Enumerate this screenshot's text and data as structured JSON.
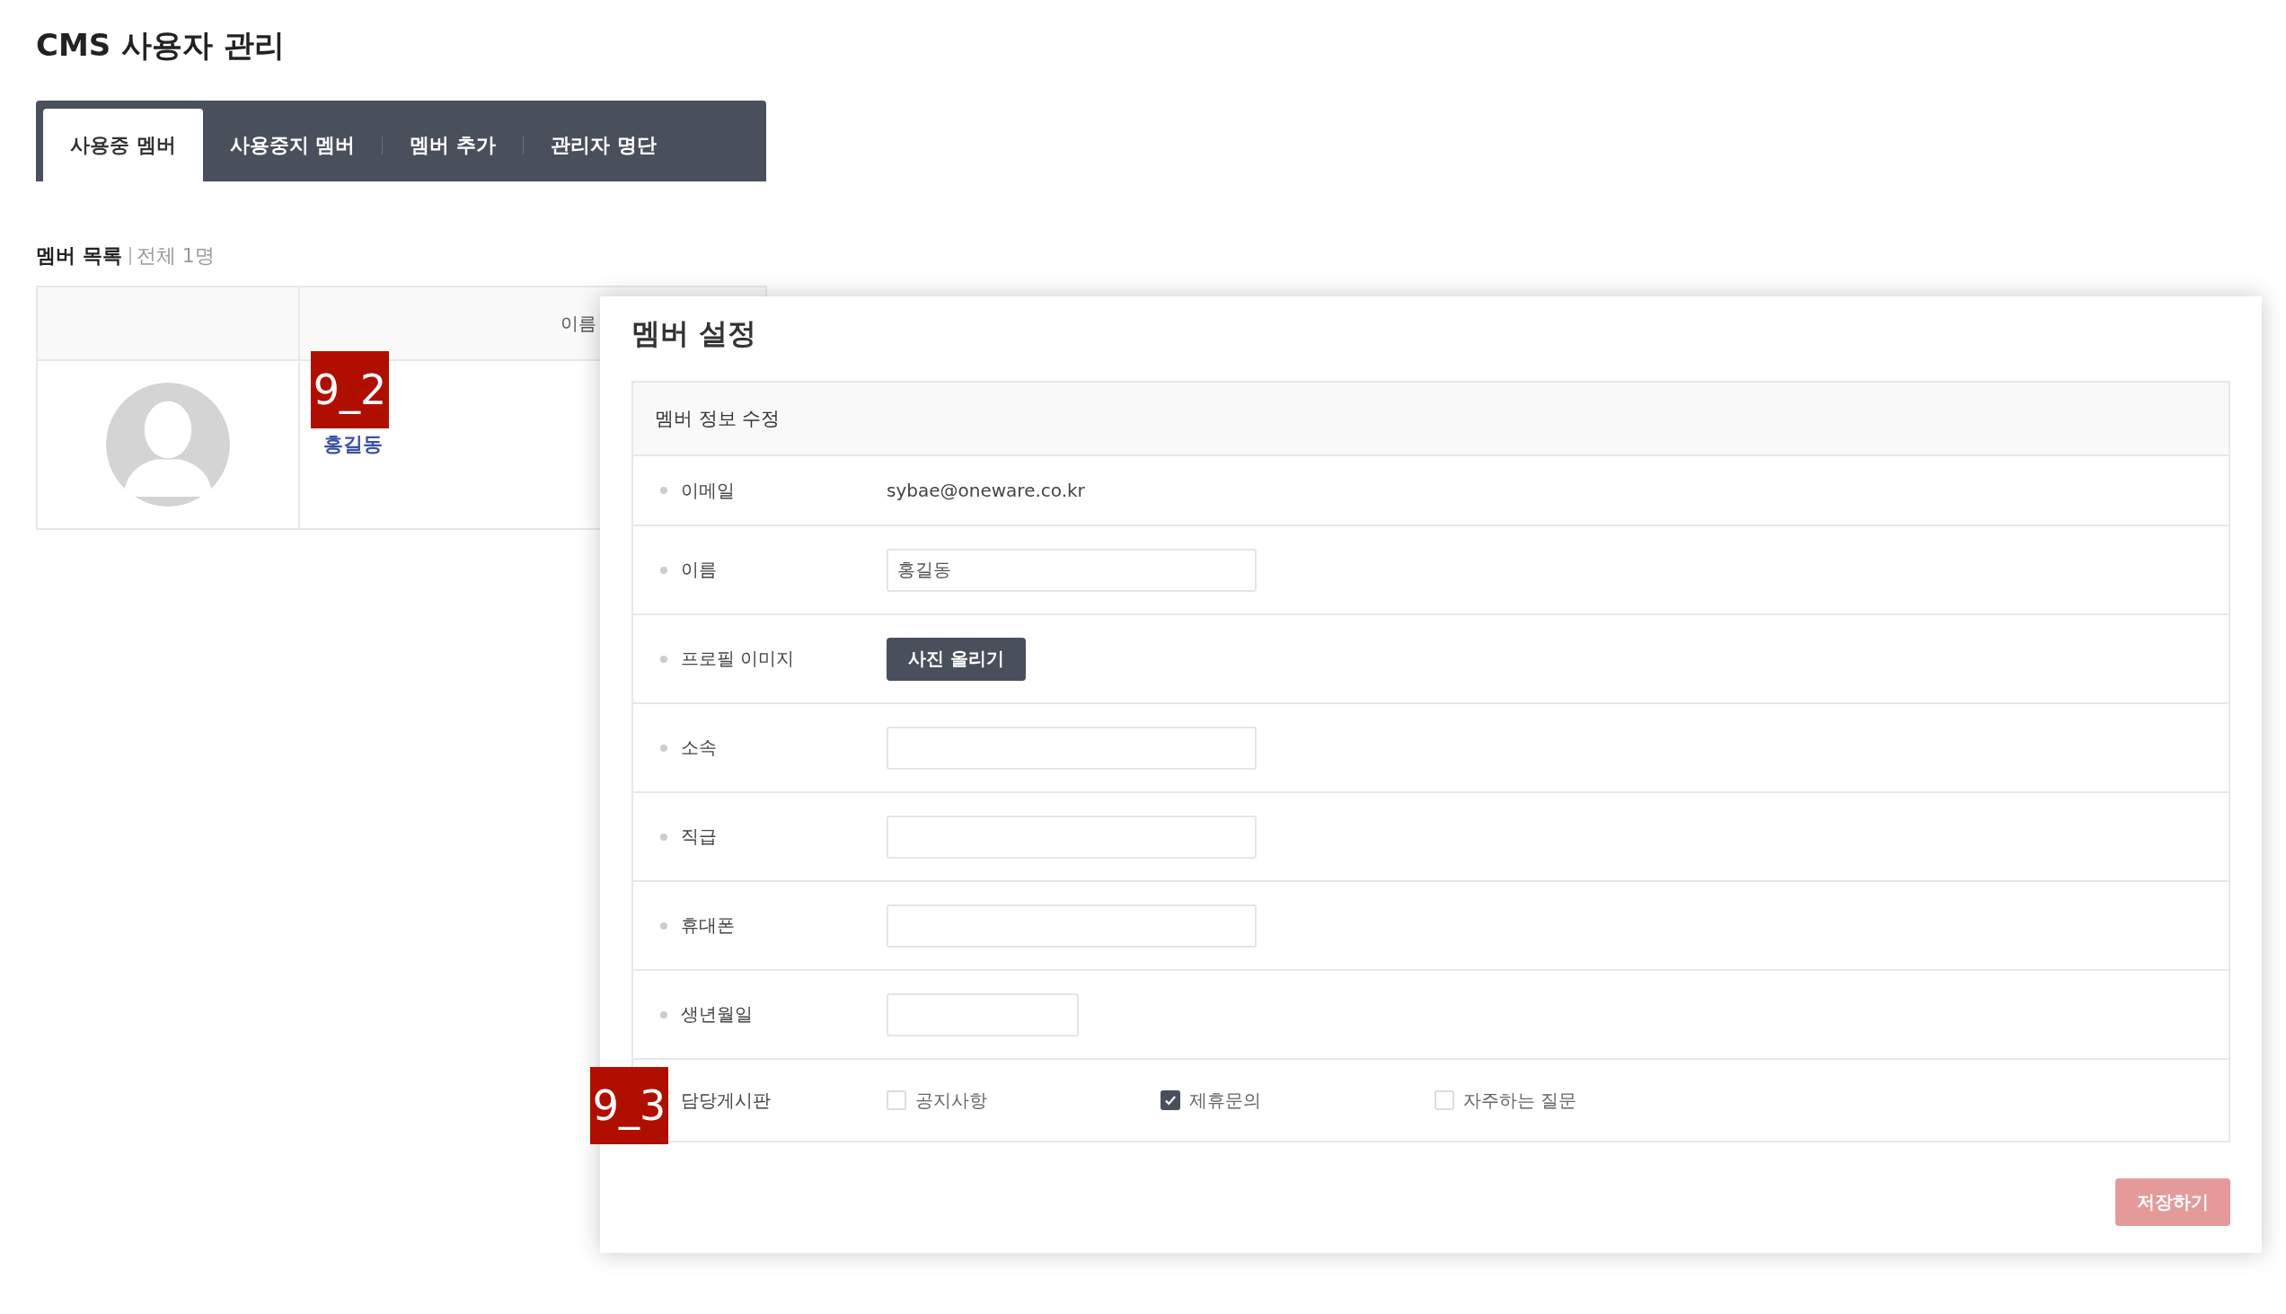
{
  "page_title": "CMS 사용자 관리",
  "tabs": [
    {
      "label": "사용중 멤버",
      "selected": true
    },
    {
      "label": "사용중지 멤버",
      "selected": false
    },
    {
      "label": "멤버 추가",
      "selected": false
    },
    {
      "label": "관리자 명단",
      "selected": false
    }
  ],
  "list": {
    "title": "멤버 목록",
    "count": "전체 1명",
    "columns": [
      "이름"
    ],
    "rows": [
      {
        "name": "홍길동"
      }
    ]
  },
  "modal": {
    "title": "멤버 설정",
    "section_title": "멤버 정보 수정",
    "fields": [
      {
        "kind": "text",
        "label": "이메일",
        "value": "sybae@oneware.co.kr"
      },
      {
        "kind": "input",
        "label": "이름",
        "value": "홍길동"
      },
      {
        "kind": "button",
        "label": "프로필 이미지",
        "button": "사진 올리기"
      },
      {
        "kind": "input",
        "label": "소속"
      },
      {
        "kind": "input",
        "label": "직급"
      },
      {
        "kind": "input",
        "label": "휴대폰"
      },
      {
        "kind": "short_input",
        "label": "생년월일"
      },
      {
        "kind": "checkboxes",
        "label": "담당게시판",
        "options": [
          {
            "label": "공지사항",
            "checked": false
          },
          {
            "label": "제휴문의",
            "checked": true
          },
          {
            "label": "자주하는 질문",
            "checked": false
          }
        ]
      }
    ],
    "save_button": "저장하기"
  },
  "annotations": [
    "9_2",
    "9_3"
  ]
}
